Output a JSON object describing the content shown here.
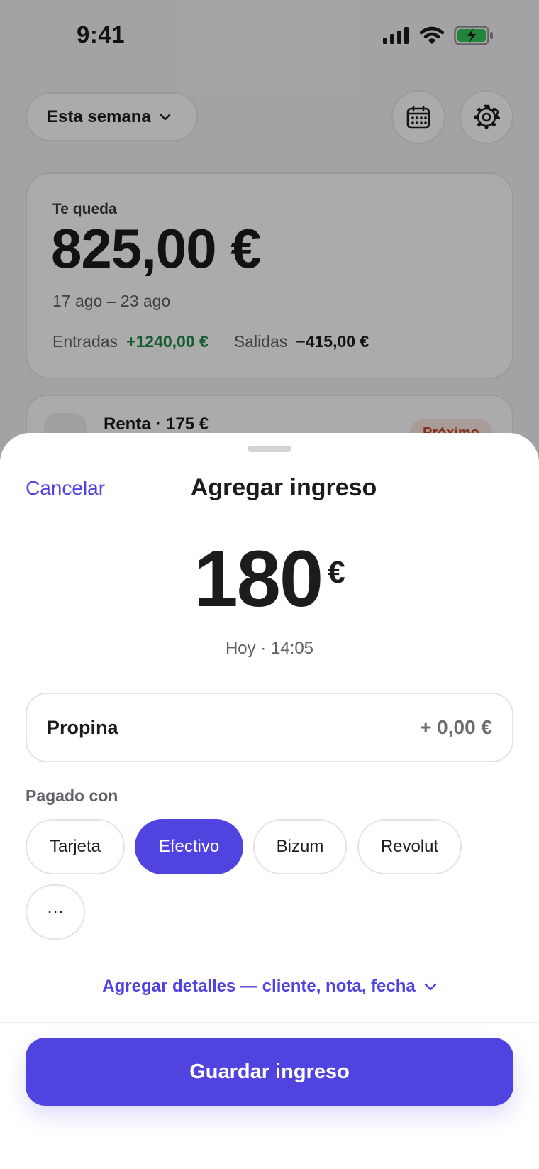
{
  "status_bar": {
    "time": "9:41",
    "icons": [
      "signal-icon",
      "wifi-icon",
      "battery-charging-icon"
    ]
  },
  "background": {
    "range_selector": {
      "label": "Esta semana",
      "icon": "chevron-down-icon"
    },
    "calendar_button_icon": "calendar-icon",
    "settings_button_icon": "gear-icon",
    "summary": {
      "label": "Te queda",
      "amount": "825,00 €",
      "date_range": "17 ago – 23 ago",
      "income_label": "Entradas",
      "income_value": "+1240,00 €",
      "expense_label": "Salidas",
      "expense_value": "−415,00 €"
    },
    "upcoming": {
      "icon": "house-icon",
      "title": "Renta · 175 €",
      "badge": "Próximo"
    }
  },
  "sheet": {
    "cancel_label": "Cancelar",
    "title": "Agregar ingreso",
    "amount": "180",
    "currency": "€",
    "timestamp": "Hoy · 14:05",
    "tip": {
      "label": "Propina",
      "value": "+ 0,00 €"
    },
    "paid_with_label": "Pagado con",
    "payment_methods": [
      {
        "label": "Tarjeta",
        "selected": false
      },
      {
        "label": "Efectivo",
        "selected": true
      },
      {
        "label": "Bizum",
        "selected": false
      },
      {
        "label": "Revolut",
        "selected": false
      },
      {
        "label": "···",
        "selected": false
      }
    ],
    "details_link": "Agregar detalles — cliente, nota, fecha",
    "save_label": "Guardar ingreso"
  },
  "colors": {
    "accent": "#5043e0",
    "income_green": "#1e8a46",
    "scrim": "rgba(0,0,0,0.33)"
  }
}
